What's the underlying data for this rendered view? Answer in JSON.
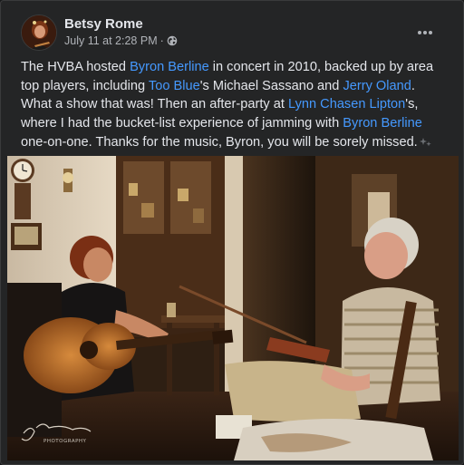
{
  "post": {
    "author": "Betsy Rome",
    "timestamp": "July 11 at 2:28 PM",
    "separator": "·",
    "privacy_icon": "globe-icon",
    "more_icon": "more-options-icon",
    "text_segments": [
      {
        "text": "The HVBA hosted ",
        "link": false
      },
      {
        "text": "Byron Berline",
        "link": true
      },
      {
        "text": " in concert in 2010, backed up by area top players, including ",
        "link": false
      },
      {
        "text": "Too Blue",
        "link": true
      },
      {
        "text": "'s Michael Sassano and ",
        "link": false
      },
      {
        "text": "Jerry Oland",
        "link": true
      },
      {
        "text": ". What a show that was! Then an after-party at ",
        "link": false
      },
      {
        "text": "Lynn Chasen Lipton",
        "link": true
      },
      {
        "text": "'s, where I had the bucket-list experience of jamming with ",
        "link": false
      },
      {
        "text": "Byron Berline",
        "link": true
      },
      {
        "text": " one-on-one. Thanks for the music, Byron, you will be sorely missed.",
        "link": false
      }
    ],
    "photo": {
      "description_icon": "photo-musicians-jamming",
      "watermark_sub": "PHOTOGRAPHY"
    }
  },
  "colors": {
    "background": "#242526",
    "text": "#e4e6eb",
    "secondary_text": "#b0b3b8",
    "link": "#4599ff"
  }
}
